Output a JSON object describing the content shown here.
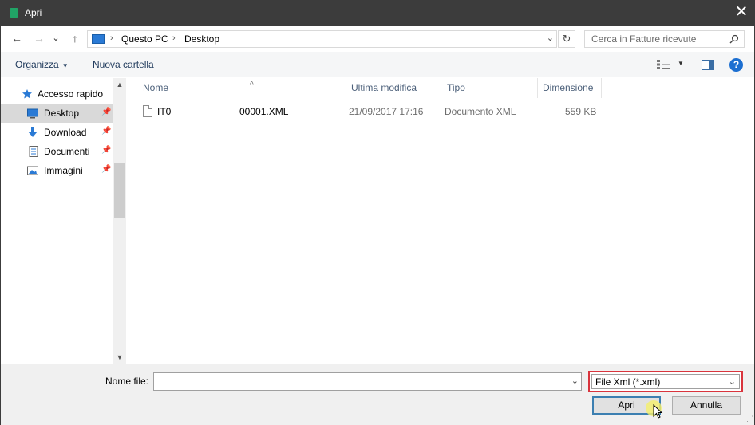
{
  "window": {
    "title": "Apri",
    "close_glyph": "✕"
  },
  "nav": {
    "back": "←",
    "forward": "→",
    "recent": "⌄",
    "up": "↑",
    "refresh": "↻"
  },
  "address": {
    "segments": [
      "Questo PC",
      "Desktop"
    ],
    "separator": "›",
    "dropdown": "⌄"
  },
  "search": {
    "placeholder": "Cerca in Fatture ricevute",
    "value": ""
  },
  "toolbar": {
    "organize": "Organizza",
    "new_folder": "Nuova cartella",
    "help": "?"
  },
  "navpane": {
    "items": [
      {
        "label": "Accesso rapido",
        "icon": "star-icon",
        "pinned": false,
        "selected": false
      },
      {
        "label": "Desktop",
        "icon": "desktop-icon",
        "pinned": true,
        "selected": true
      },
      {
        "label": "Download",
        "icon": "download-icon",
        "pinned": true,
        "selected": false
      },
      {
        "label": "Documenti",
        "icon": "documents-icon",
        "pinned": true,
        "selected": false
      },
      {
        "label": "Immagini",
        "icon": "pictures-icon",
        "pinned": true,
        "selected": false
      }
    ],
    "pin_glyph": "📌"
  },
  "filelist": {
    "columns": [
      "Nome",
      "Ultima modifica",
      "Tipo",
      "Dimensione"
    ],
    "sort_glyph": "^",
    "files": [
      {
        "name_start": "IT0",
        "name_end": "00001.XML",
        "modified": "21/09/2017 17:16",
        "type": "Documento XML",
        "size": "559 KB"
      }
    ]
  },
  "bottom": {
    "filename_label": "Nome file:",
    "filename_value": "",
    "filter_value": "File Xml (*.xml)",
    "open_label": "Apri",
    "cancel_label": "Annulla"
  },
  "colors": {
    "titlebar": "#3c3c3c",
    "accent": "#1c6fd1",
    "highlight_border": "#d9343d",
    "selected_row": "#d9d9d9"
  }
}
